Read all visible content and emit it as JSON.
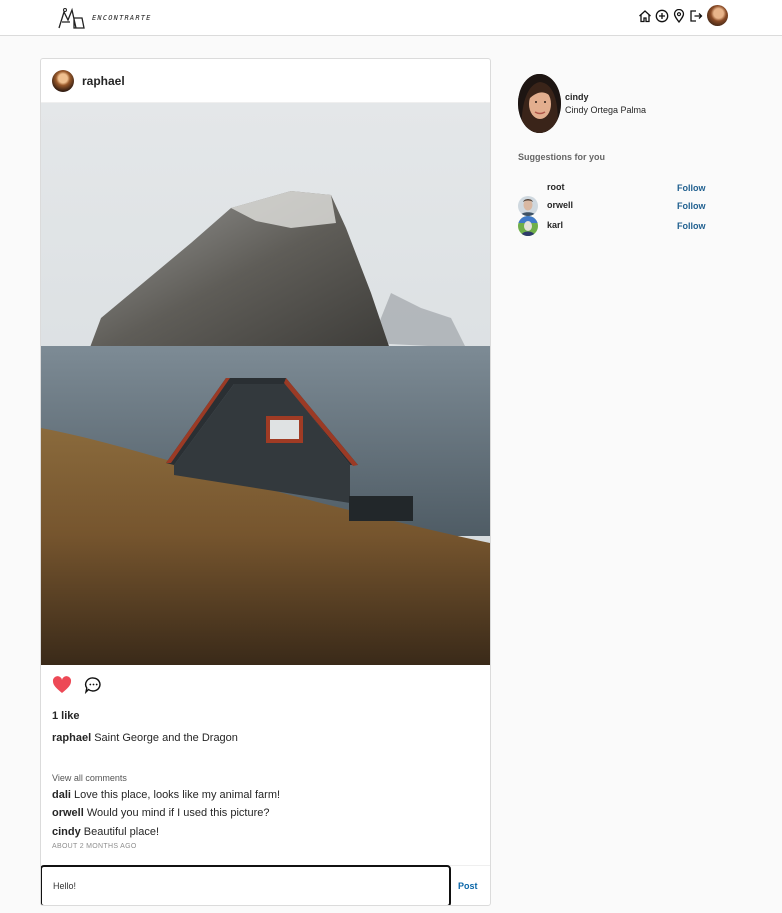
{
  "header": {
    "logo_text": "ENCONTRARTE",
    "nav_icons": [
      "home-icon",
      "add-post-icon",
      "location-icon",
      "logout-icon"
    ]
  },
  "post": {
    "username": "raphael",
    "likes": "1 like",
    "caption_user": "raphael",
    "caption_text": "Saint George and the Dragon",
    "view_all": "View all comments",
    "comments": [
      {
        "user": "dali",
        "text": "Love this place, looks like my animal farm!"
      },
      {
        "user": "orwell",
        "text": "Would you mind if I used this picture?"
      },
      {
        "user": "cindy",
        "text": "Beautiful place!"
      }
    ],
    "time_ago": "ABOUT 2 MONTHS AGO",
    "comment_input_value": "Hello!",
    "post_button": "Post",
    "like_color": "#ed4956"
  },
  "sidebar": {
    "username": "cindy",
    "full_name": "Cindy Ortega Palma",
    "suggestions_title": "Suggestions for you",
    "suggestions": [
      {
        "username": "root",
        "follow_label": "Follow"
      },
      {
        "username": "orwell",
        "follow_label": "Follow"
      },
      {
        "username": "karl",
        "follow_label": "Follow"
      }
    ],
    "follow_color": "#1f5f8f"
  }
}
